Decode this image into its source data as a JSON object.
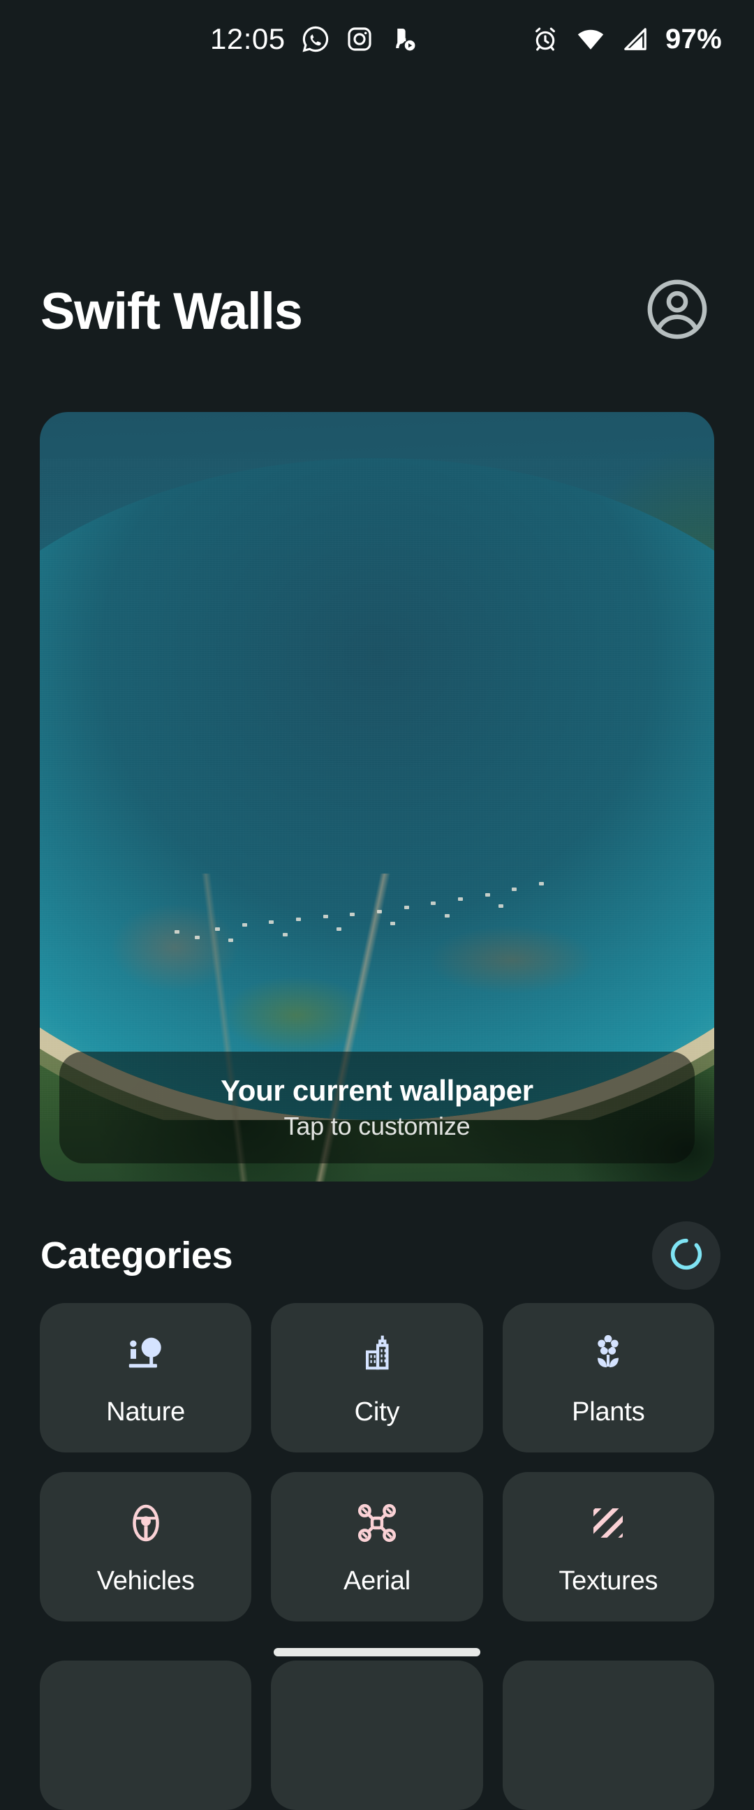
{
  "statusbar": {
    "time": "12:05",
    "battery": "97%",
    "left_icons": [
      "whatsapp-icon",
      "instagram-icon",
      "media-app-icon"
    ],
    "right_icons": [
      "alarm-icon",
      "wifi-icon",
      "cellular-signal-icon"
    ]
  },
  "appbar": {
    "title": "Swift Walls",
    "account_icon": "account-circle-icon"
  },
  "wallpaper": {
    "overlay_title": "Your current wallpaper",
    "overlay_subtitle": "Tap to customize",
    "image_description": "aerial satellite view of a coastal bay with teal water, sandy beach and green farmland"
  },
  "categories_section": {
    "title": "Categories",
    "refresh_icon": "refresh-spinner-icon",
    "items": [
      {
        "label": "Nature",
        "icon": "park-icon",
        "color": "#D5E3FF"
      },
      {
        "label": "City",
        "icon": "buildings-icon",
        "color": "#D5E3FF"
      },
      {
        "label": "Plants",
        "icon": "flower-icon",
        "color": "#D5E3FF"
      },
      {
        "label": "Vehicles",
        "icon": "steering-wheel-icon",
        "color": "#FBD2D6"
      },
      {
        "label": "Aerial",
        "icon": "drone-icon",
        "color": "#FBD2D6"
      },
      {
        "label": "Textures",
        "icon": "diagonal-stripes-icon",
        "color": "#FBD2D6"
      }
    ]
  },
  "colors": {
    "background": "#151C1E",
    "card": "#2C3434",
    "accent_cyan": "#7FE4F4",
    "icon_blue": "#D5E3FF",
    "icon_pink": "#FBD2D6",
    "text_primary": "#FFFFFF"
  },
  "navigation": {
    "gesture_bar": "home-gesture-bar"
  }
}
